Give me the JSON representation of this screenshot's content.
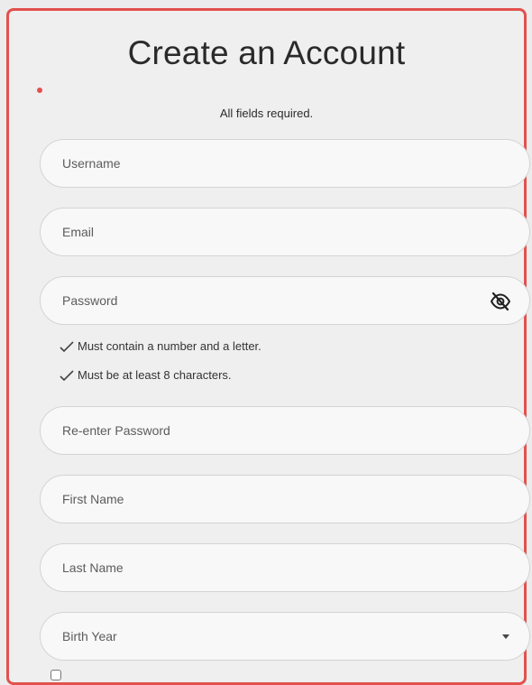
{
  "form": {
    "title": "Create an Account",
    "required_note": "All fields required.",
    "fields": {
      "username": {
        "placeholder": "Username"
      },
      "email": {
        "placeholder": "Email"
      },
      "password": {
        "placeholder": "Password",
        "icon": "eye-off-icon"
      },
      "reenter_password": {
        "placeholder": "Re-enter Password"
      },
      "first_name": {
        "placeholder": "First Name"
      },
      "last_name": {
        "placeholder": "Last Name"
      },
      "birth_year": {
        "placeholder": "Birth Year",
        "icon": "chevron-down-icon"
      }
    },
    "password_rules": [
      "Must contain a number and a letter.",
      "Must be at least 8 characters."
    ]
  },
  "colors": {
    "border_accent": "#e2514d",
    "background": "#efefef",
    "field_background": "#f8f8f8"
  }
}
